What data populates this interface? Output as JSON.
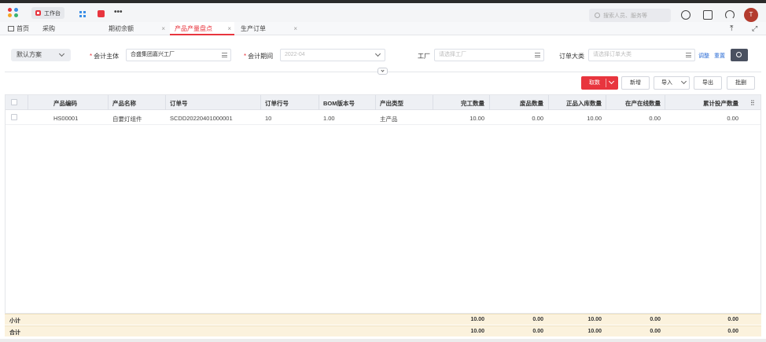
{
  "topbar": {
    "workbench_label": "工作台",
    "search_placeholder": "搜索人员、服务等",
    "avatar_initial": "T"
  },
  "tabs": [
    {
      "label": "首页"
    },
    {
      "label": "采购"
    },
    {
      "label": "期初余额"
    },
    {
      "label": "产品产量盘点"
    },
    {
      "label": "生产订单"
    }
  ],
  "filters": {
    "scheme": "默认方案",
    "accounting_entity_label": "会计主体",
    "accounting_entity_value": "合盛集团嘉兴工厂",
    "accounting_period_label": "会计期间",
    "accounting_period_value": "2022-04",
    "factory_label": "工厂",
    "factory_placeholder": "请选择工厂",
    "order_category_label": "订单大类",
    "order_category_placeholder": "请选择订单大类",
    "adjust_link": "调整",
    "reset_link": "重置"
  },
  "actions": {
    "fetch": "取数",
    "add": "新增",
    "import": "导入",
    "export": "导出",
    "batch_delete": "批删"
  },
  "table": {
    "columns": [
      "产品编码",
      "产品名称",
      "订单号",
      "订单行号",
      "BOM版本号",
      "产出类型",
      "完工数量",
      "废品数量",
      "正品入库数量",
      "在产在线数量",
      "累计投产数量"
    ],
    "rows": [
      [
        "HS00001",
        "自要灯组件",
        "SCDD20220401000001",
        "10",
        "1.00",
        "主产品",
        "10.00",
        "0.00",
        "10.00",
        "0.00",
        "0.00"
      ]
    ]
  },
  "footer": {
    "subtotal_label": "小计",
    "total_label": "合计",
    "subtotal": [
      "10.00",
      "0.00",
      "10.00",
      "0.00",
      "0.00"
    ],
    "total": [
      "10.00",
      "0.00",
      "10.00",
      "0.00",
      "0.00"
    ]
  },
  "colors": {
    "accent": "#e8353e",
    "header_bg": "#eef0f4",
    "footer_bg": "#fbf2dd"
  }
}
